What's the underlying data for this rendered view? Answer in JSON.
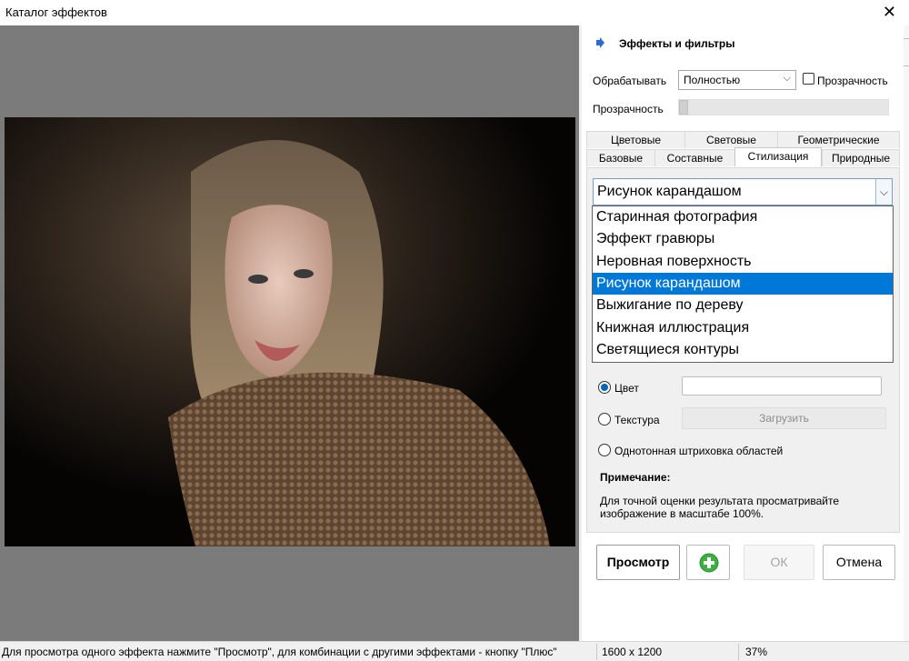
{
  "window": {
    "title": "Каталог эффектов"
  },
  "panel": {
    "header": "Эффекты и фильтры",
    "process_label": "Обрабатывать",
    "process_value": "Полностью",
    "transparency_checkbox_label": "Прозрачность",
    "transparency_checked": false,
    "transparency_slider_label": "Прозрачность",
    "transparency_level": 0
  },
  "tabs": {
    "row1": [
      "Цветовые",
      "Световые",
      "Геометрические"
    ],
    "row2": [
      "Базовые",
      "Составные",
      "Стилизация",
      "Природные"
    ],
    "active": "Стилизация"
  },
  "effect": {
    "selected": "Рисунок карандашом",
    "options": [
      "Старинная фотография",
      "Эффект гравюры",
      "Неровная поверхность",
      "Рисунок карандашом",
      "Выжигание по дереву",
      "Книжная иллюстрация",
      "Светящиеся контуры"
    ],
    "selected_index": 3
  },
  "fill": {
    "color_label": "Цвет",
    "texture_label": "Текстура",
    "load_button": "Загрузить",
    "solid_hatch_label": "Однотонная штриховка областей",
    "selected": "color"
  },
  "note": {
    "title": "Примечание:",
    "text": "Для точной оценки результата просматривайте изображение в масштабе 100%."
  },
  "buttons": {
    "preview": "Просмотр",
    "ok": "ОК",
    "cancel": "Отмена"
  },
  "status": {
    "hint": "Для просмотра одного эффекта нажмите \"Просмотр\", для комбинации с другими эффектами - кнопку \"Плюс\"",
    "image_size": "1600 x 1200",
    "zoom": "37%"
  }
}
